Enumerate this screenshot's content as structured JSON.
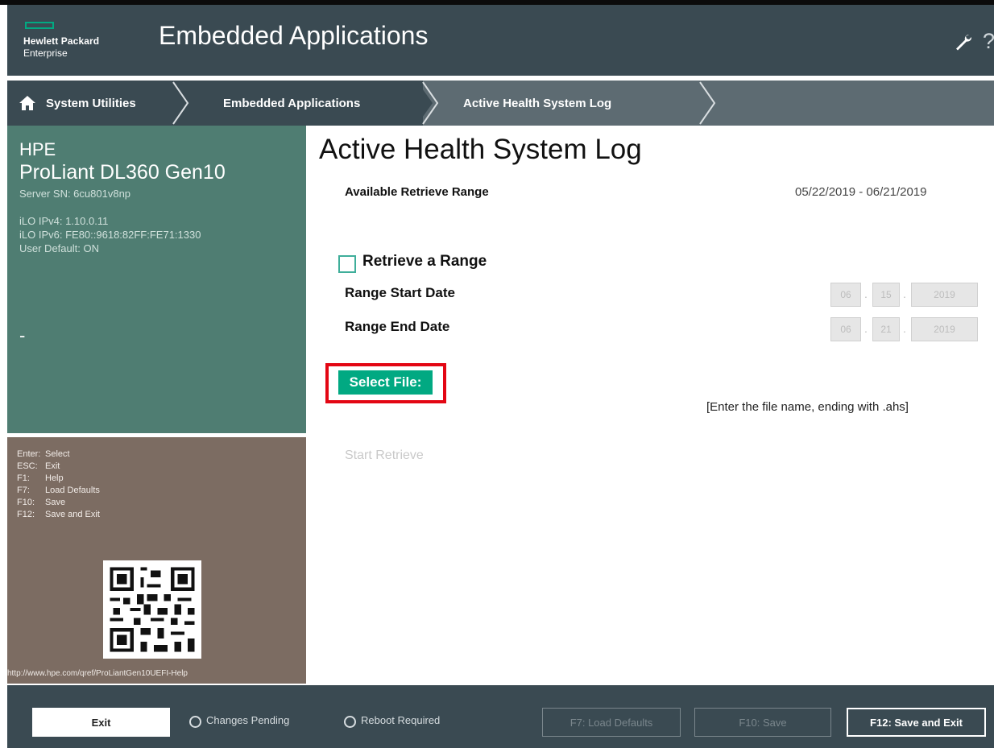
{
  "header": {
    "logo_line1": "Hewlett Packard",
    "logo_line2": "Enterprise",
    "title": "Embedded Applications",
    "help_glyph": "?"
  },
  "breadcrumb": {
    "items": [
      "System Utilities",
      "Embedded Applications",
      "Active Health System Log"
    ]
  },
  "server_info": {
    "brand": "HPE",
    "model": "ProLiant DL360 Gen10",
    "serial": "Server SN: 6cu801v8np",
    "ilo_ipv4": "iLO IPv4: 1.10.0.11",
    "ilo_ipv6": "iLO IPv6: FE80::9618:82FF:FE71:1330",
    "user_default": "User Default: ON",
    "dash": "-"
  },
  "keys": [
    {
      "key": "Enter:",
      "action": "Select"
    },
    {
      "key": "ESC:",
      "action": "Exit"
    },
    {
      "key": "F1:",
      "action": "Help"
    },
    {
      "key": "F7:",
      "action": "Load Defaults"
    },
    {
      "key": "F10:",
      "action": "Save"
    },
    {
      "key": "F12:",
      "action": "Save and Exit"
    }
  ],
  "help_url": "http://www.hpe.com/qref/ProLiantGen10UEFI-Help",
  "main": {
    "title": "Active Health System Log",
    "available_range_label": "Available Retrieve Range",
    "available_range_value": "05/22/2019 - 06/21/2019",
    "retrieve_range_label": "Retrieve a Range",
    "retrieve_range_checked": false,
    "start_date_label": "Range Start Date",
    "start_date": {
      "month": "06",
      "day": "15",
      "year": "2019"
    },
    "end_date_label": "Range End Date",
    "end_date": {
      "month": "06",
      "day": "21",
      "year": "2019"
    },
    "select_file_label": "Select File:",
    "file_hint": "[Enter the file name, ending with .ahs]",
    "start_retrieve_label": "Start Retrieve"
  },
  "footer": {
    "exit_label": "Exit",
    "changes_pending_label": "Changes Pending",
    "reboot_required_label": "Reboot Required",
    "load_defaults_label": "F7: Load Defaults",
    "save_label": "F10: Save",
    "save_exit_label": "F12: Save and Exit"
  },
  "colors": {
    "header_bg": "#3a4a52",
    "info_panel_bg": "#4f7d72",
    "keys_panel_bg": "#7c6c62",
    "accent_green": "#01a982",
    "highlight_red": "#e30613"
  }
}
